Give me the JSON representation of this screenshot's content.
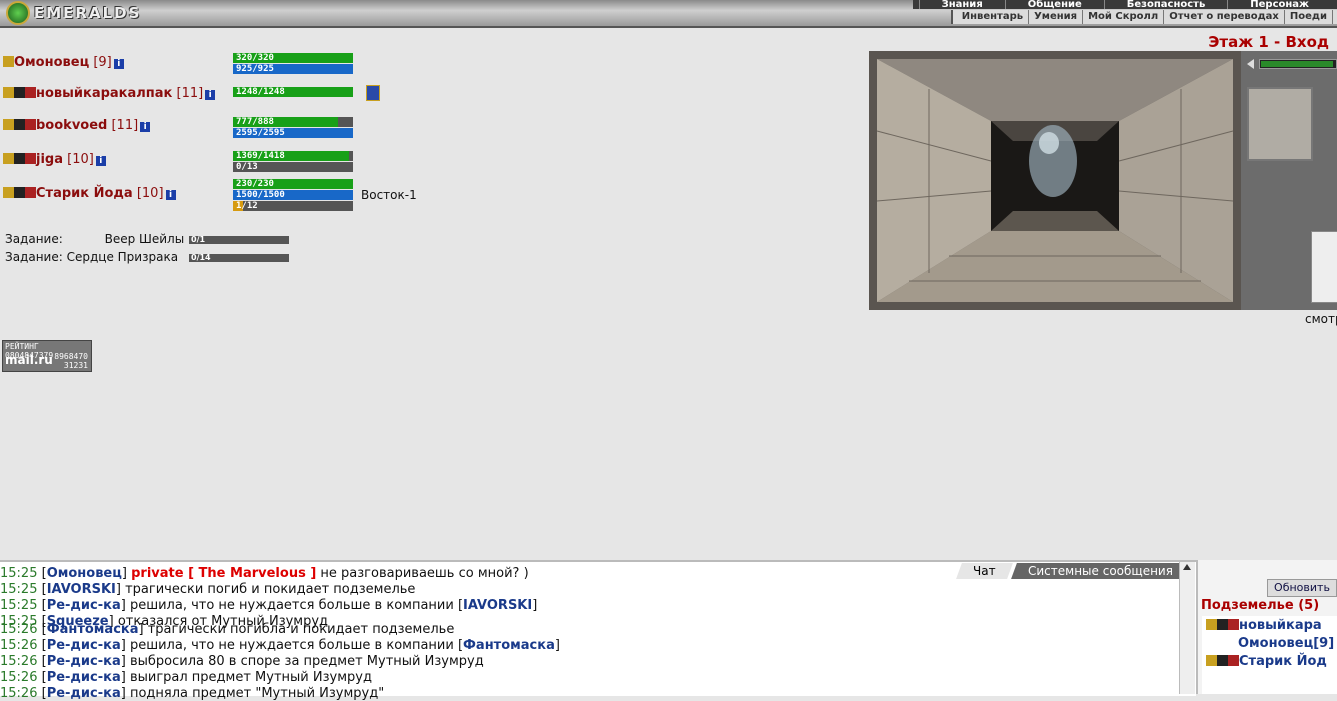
{
  "app": {
    "logo_text": "EMERALDS"
  },
  "menu": {
    "primary": [
      "Знания",
      "Общение",
      "Безопасность",
      "Персонаж"
    ],
    "secondary": [
      "Инвентарь",
      "Умения",
      "Мой Скролл",
      "Отчет о переводах",
      "Поеди"
    ]
  },
  "location": {
    "title": "Этаж 1 - Вход",
    "look_label": "смотр"
  },
  "party": [
    {
      "name": "Омоновец",
      "level": "[9]",
      "bars": [
        {
          "text": "320/320",
          "fill": 1.0,
          "color": "g"
        },
        {
          "text": "925/925",
          "fill": 1.0,
          "color": "b"
        }
      ]
    },
    {
      "name": "новыйкаракалпак",
      "level": "[11]",
      "bars": [
        {
          "text": "1248/1248",
          "fill": 1.0,
          "color": "g"
        }
      ]
    },
    {
      "name": "bookvoed",
      "level": "[11]",
      "bars": [
        {
          "text": "777/888",
          "fill": 0.875,
          "color": "g"
        },
        {
          "text": "2595/2595",
          "fill": 1.0,
          "color": "b"
        }
      ]
    },
    {
      "name": "jiga",
      "level": "[10]",
      "bars": [
        {
          "text": "1369/1418",
          "fill": 0.965,
          "color": "g"
        },
        {
          "text": "0/13",
          "fill": 0.0,
          "color": "b"
        }
      ]
    },
    {
      "name": "Старик Йода",
      "level": "[10]",
      "bars": [
        {
          "text": "230/230",
          "fill": 1.0,
          "color": "g"
        },
        {
          "text": "1500/1500",
          "fill": 1.0,
          "color": "b"
        },
        {
          "text": "1/12",
          "fill": 0.083,
          "color": "o"
        }
      ],
      "location": "Восток-1"
    }
  ],
  "tasks": [
    {
      "label": "Задание:",
      "name": "Веер Шейлы",
      "progress": "0/1"
    },
    {
      "label": "Задание:",
      "name": "Сердце Призрака",
      "progress": "0/14"
    }
  ],
  "counter": {
    "title": "РЕЙТИНГ",
    "brand": "mail.ru",
    "num1": "0804847379",
    "num2": "8968470",
    "num3": "31231"
  },
  "chat": {
    "tabs": [
      "Чат",
      "Системные сообщения"
    ],
    "lines": [
      {
        "time": "15:25",
        "user": "Омоновец",
        "private": "private [ The Marvelous ]",
        "text": " не разговариваешь со мной? )"
      },
      {
        "time": "15:25",
        "user": "IAVORSKI",
        "text": " трагически погиб и покидает подземелье"
      },
      {
        "time": "15:25",
        "user": "Ре-дис-ка",
        "text": " решила, что не нуждается больше в компании ",
        "user2": "IAVORSKI"
      },
      {
        "time": "15:25",
        "user": "Squeeze",
        "text": " отказался от Мутный Изумруд"
      },
      {
        "time": "15:26",
        "user": "Фантомаска",
        "text": " трагически погибла и покидает подземелье"
      },
      {
        "time": "15:26",
        "user": "Ре-дис-ка",
        "text": " решила, что не нуждается больше в компании ",
        "user2": "Фантомаска"
      },
      {
        "time": "15:26",
        "user": "Ре-дис-ка",
        "text": " выбросила 80 в споре за предмет Мутный Изумруд"
      },
      {
        "time": "15:26",
        "user": "Ре-дис-ка",
        "text": " выиграл предмет Мутный Изумруд"
      },
      {
        "time": "15:26",
        "user": "Ре-дис-ка",
        "text": " подняла предмет \"Мутный Изумруд\""
      }
    ]
  },
  "users_panel": {
    "refresh_label": "Обновить",
    "title": "Подземелье (5)",
    "users": [
      "новыйкара",
      "Омоновец[9]",
      "Старик Йод"
    ]
  }
}
